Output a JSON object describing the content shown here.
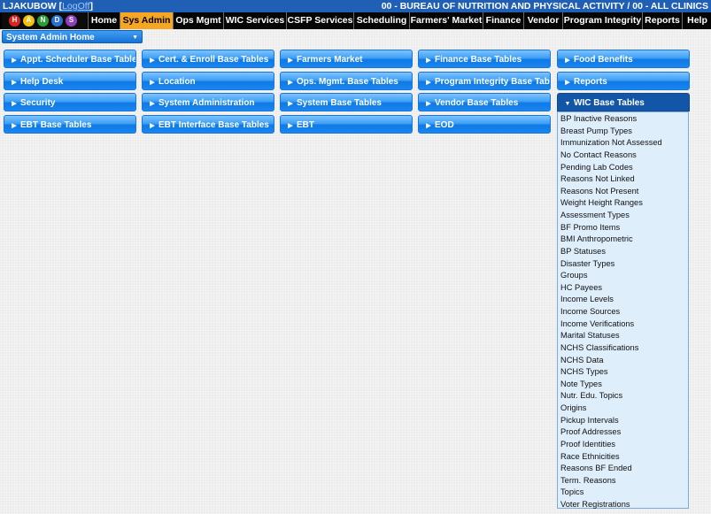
{
  "header": {
    "user": "LJAKUBOW",
    "logout": "LogOff",
    "agency": "00 - BUREAU OF NUTRITION AND PHYSICAL ACTIVITY / 00 - ALL CLINICS"
  },
  "logo": {
    "letters": [
      "H",
      "A",
      "N",
      "D",
      "S"
    ]
  },
  "nav": {
    "items": [
      {
        "label": "Home"
      },
      {
        "label": "Sys Admin",
        "active": true
      },
      {
        "label": "Ops Mgmt"
      },
      {
        "label": "WIC Services"
      },
      {
        "label": "CSFP Services"
      },
      {
        "label": "Scheduling"
      },
      {
        "label": "Farmers' Market"
      },
      {
        "label": "Finance"
      },
      {
        "label": "Vendor"
      },
      {
        "label": "Program Integrity"
      },
      {
        "label": "Reports"
      },
      {
        "label": "Help"
      }
    ]
  },
  "subnav": {
    "selected": "System Admin Home"
  },
  "menu": {
    "buttons": [
      {
        "label": "Appt. Scheduler Base Tables"
      },
      {
        "label": "Cert. & Enroll Base Tables"
      },
      {
        "label": "Farmers Market"
      },
      {
        "label": "Finance Base Tables"
      },
      {
        "label": "Food Benefits"
      },
      {
        "label": "Help Desk"
      },
      {
        "label": "Location"
      },
      {
        "label": "Ops. Mgmt. Base Tables"
      },
      {
        "label": "Program Integrity Base Tables"
      },
      {
        "label": "Reports"
      },
      {
        "label": "Security"
      },
      {
        "label": "System Administration"
      },
      {
        "label": "System Base Tables"
      },
      {
        "label": "Vendor Base Tables"
      },
      {
        "label": "WIC Base Tables",
        "open": true
      },
      {
        "label": "EBT Base Tables"
      },
      {
        "label": "EBT Interface Base Tables"
      },
      {
        "label": "EBT"
      },
      {
        "label": "EOD"
      }
    ]
  },
  "dropdown": {
    "items": [
      "BP Inactive Reasons",
      "Breast Pump Types",
      "Immunization Not Assessed",
      "No Contact Reasons",
      "Pending Lab Codes",
      "Reasons Not Linked",
      "Reasons Not Present",
      "Weight Height Ranges",
      "Assessment Types",
      "BF Promo Items",
      "BMI Anthropometric",
      "BP Statuses",
      "Disaster Types",
      "Groups",
      "HC Payees",
      "Income Levels",
      "Income Sources",
      "Income Verifications",
      "Marital Statuses",
      "NCHS Classifications",
      "NCHS Data",
      "NCHS Types",
      "Note Types",
      "Nutr. Edu. Topics",
      "Origins",
      "Pickup Intervals",
      "Proof Addresses",
      "Proof Identities",
      "Race Ethnicities",
      "Reasons BF Ended",
      "Term. Reasons",
      "Topics",
      "Voter Registrations"
    ]
  },
  "colors": {
    "header_bg": "#1f5fb5",
    "nav_bg": "#000000",
    "nav_active": "#f5a623",
    "button_blue": "#1a86ee",
    "button_open": "#1356a8",
    "dropdown_bg": "#dfeefb"
  }
}
